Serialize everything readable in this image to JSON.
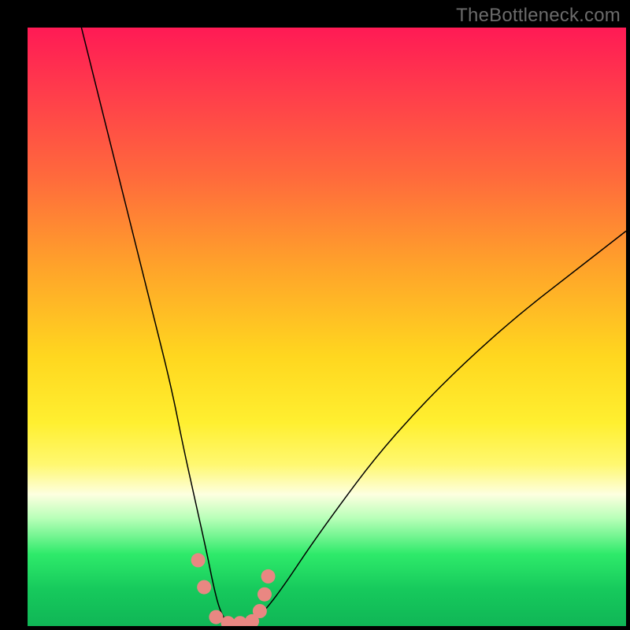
{
  "watermark": "TheBottleneck.com",
  "chart_data": {
    "type": "line",
    "title": "",
    "xlabel": "",
    "ylabel": "",
    "xlim": [
      0,
      100
    ],
    "ylim": [
      0,
      100
    ],
    "grid": false,
    "legend": "none",
    "background_gradient": {
      "direction": "vertical",
      "stops": [
        {
          "pos": 0.0,
          "color": "#ff1a55"
        },
        {
          "pos": 0.1,
          "color": "#ff3a4c"
        },
        {
          "pos": 0.25,
          "color": "#ff6a3c"
        },
        {
          "pos": 0.4,
          "color": "#ffa32a"
        },
        {
          "pos": 0.55,
          "color": "#ffd71f"
        },
        {
          "pos": 0.66,
          "color": "#ffef30"
        },
        {
          "pos": 0.73,
          "color": "#fff870"
        },
        {
          "pos": 0.78,
          "color": "#fdffe0"
        },
        {
          "pos": 0.82,
          "color": "#b8ffb8"
        },
        {
          "pos": 0.88,
          "color": "#2eea6a"
        },
        {
          "pos": 0.94,
          "color": "#16c95c"
        },
        {
          "pos": 1.0,
          "color": "#10b656"
        }
      ]
    },
    "series": [
      {
        "name": "v-curve",
        "stroke": "#000000",
        "stroke_width": 1.5,
        "x": [
          9,
          12,
          15,
          18,
          21,
          24,
          26,
          28,
          30,
          31,
          32,
          33,
          34,
          36,
          38,
          40,
          43,
          47,
          52,
          58,
          65,
          73,
          82,
          91,
          100
        ],
        "y": [
          100,
          88,
          76,
          64,
          52,
          40,
          30,
          21,
          12,
          7,
          3,
          1,
          0,
          0,
          1,
          3,
          7,
          13,
          20,
          28,
          36,
          44,
          52,
          59,
          66
        ]
      }
    ],
    "markers": [
      {
        "name": "trough-markers",
        "color": "#e98782",
        "radius": 9,
        "points_xy": [
          [
            28.5,
            11
          ],
          [
            29.5,
            6.5
          ],
          [
            31.5,
            1.5
          ],
          [
            33.5,
            0.5
          ],
          [
            35.5,
            0.5
          ],
          [
            37.5,
            0.8
          ],
          [
            38.8,
            2.5
          ],
          [
            39.6,
            5.3
          ],
          [
            40.2,
            8.3
          ]
        ]
      }
    ],
    "annotations": []
  }
}
